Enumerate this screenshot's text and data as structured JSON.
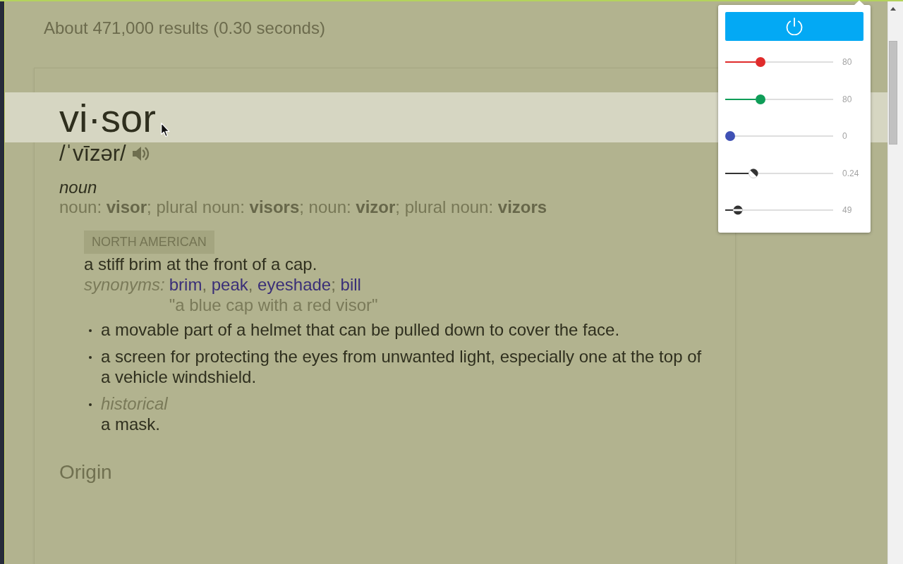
{
  "results_summary": "About 471,000 results (0.30 seconds)",
  "entry": {
    "headword": "vi·sor",
    "pronunciation": "/ˈvīzər/",
    "part_of_speech": "noun",
    "forms": "noun: **visor**; plural noun: **visors**; noun: **vizor**; plural noun: **vizors**",
    "senses": [
      {
        "kind": "main",
        "region": "NORTH AMERICAN",
        "definition": "a stiff brim at the front of a cap.",
        "synonyms_label": "synonyms:",
        "synonyms": [
          {
            "word": "brim",
            "separator": ","
          },
          {
            "word": "peak",
            "separator": ","
          },
          {
            "word": "eyeshade",
            "separator": ";"
          },
          {
            "word": "bill"
          }
        ],
        "example": "\"a blue cap with a red visor\""
      },
      {
        "kind": "bullet",
        "definition": "a movable part of a helmet that can be pulled down to cover the face."
      },
      {
        "kind": "bullet",
        "definition": "a screen for protecting the eyes from unwanted light, especially one at the top of a vehicle windshield."
      },
      {
        "kind": "bullet",
        "label": "historical",
        "definition": "a mask."
      }
    ],
    "origin_heading": "Origin"
  },
  "color_filter_popup": {
    "sliders": [
      {
        "kind": "solid",
        "color": "#e02b2b",
        "level": 0.31,
        "reading": "80"
      },
      {
        "kind": "solid",
        "color": "#0f9d58",
        "level": 0.31,
        "reading": "80"
      },
      {
        "kind": "solid",
        "color": "#3f51b5",
        "level": 0,
        "reading": "0"
      },
      {
        "kind": "split",
        "color": "#333333",
        "level": 0.24,
        "reading": "0.24"
      },
      {
        "kind": "banded",
        "color": "#333333",
        "level": 0.08,
        "reading": "49"
      }
    ]
  }
}
